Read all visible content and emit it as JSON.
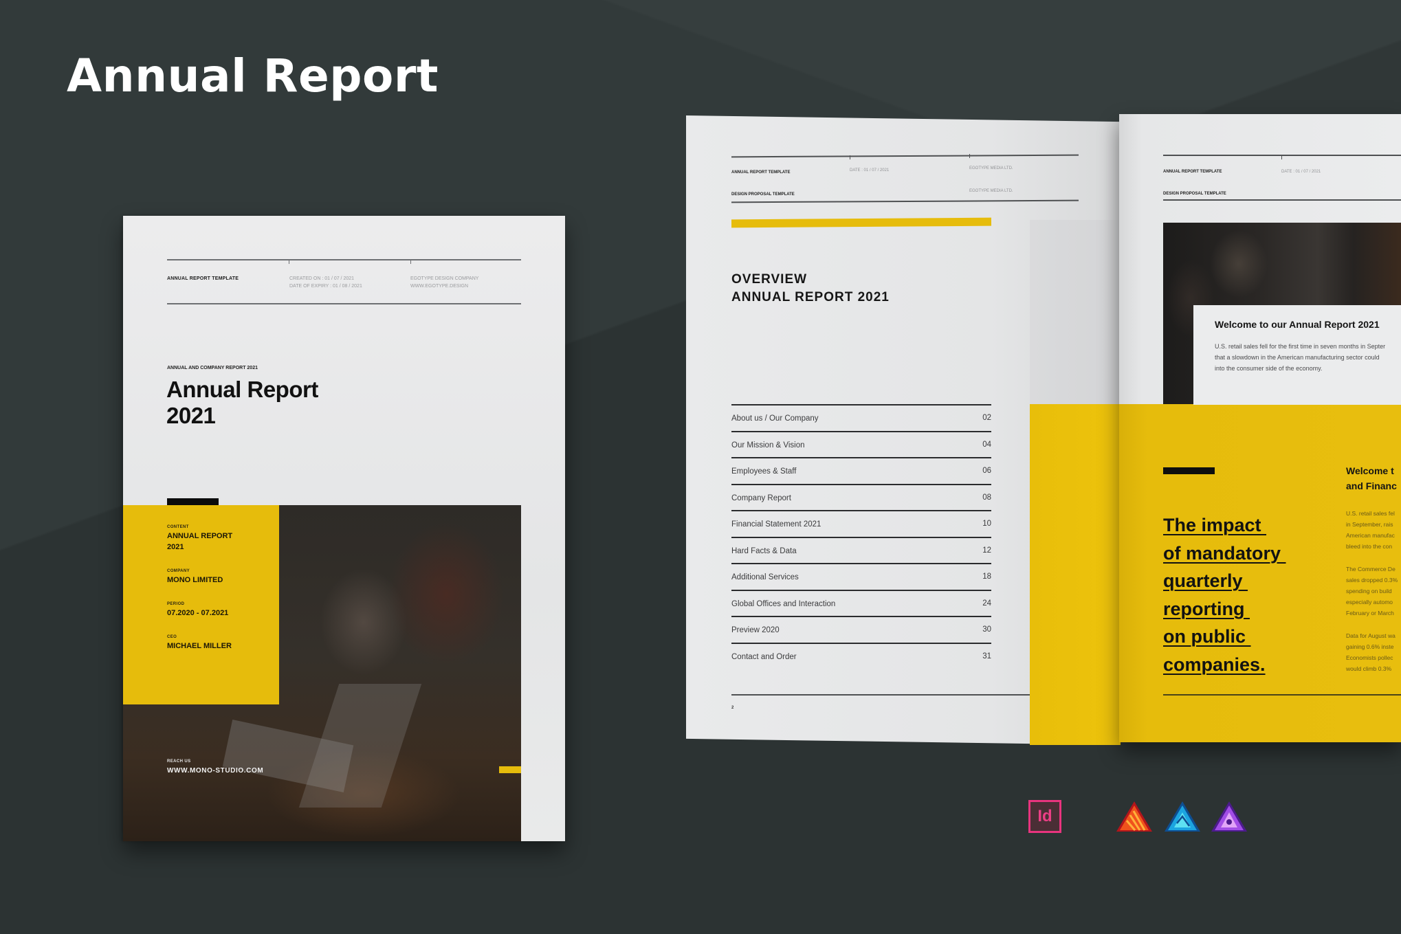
{
  "page_title": "Annual Report",
  "cover": {
    "header": {
      "label": "ANNUAL REPORT TEMPLATE",
      "created_on": "CREATED ON : 01 / 07 / 2021",
      "date_of_expiry": "DATE OF EXPIRY : 01 / 08 / 2021",
      "company": "EGOTYPE DESIGN COMPANY",
      "website": "WWW.EGOTYPE.DESIGN"
    },
    "subtitle": "ANNUAL AND COMPANY REPORT 2021",
    "title_line1": "Annual Report",
    "title_line2": "2021",
    "details": [
      {
        "label": "CONTENT",
        "value_line1": "ANNUAL REPORT",
        "value_line2": "2021"
      },
      {
        "label": "COMPANY",
        "value_line1": "MONO LIMITED"
      },
      {
        "label": "PERIOD",
        "value_line1": "07.2020 - 07.2021"
      },
      {
        "label": "CEO",
        "value_line1": "MICHAEL MILLER"
      }
    ],
    "reach_label": "REACH US",
    "reach_url": "WWW.MONO-STUDIO.COM"
  },
  "spread_left": {
    "header": {
      "label1": "ANNUAL REPORT TEMPLATE",
      "label2": "DESIGN PROPOSAL TEMPLATE",
      "date": "DATE : 01 / 07 / 2021",
      "company1": "EGOTYPE MEDIA LTD.",
      "company2": "EGOTYPE MEDIA LTD."
    },
    "overview_line1": "OVERVIEW",
    "overview_line2": "ANNUAL REPORT 2021",
    "toc": [
      {
        "label": "About us / Our Company",
        "page": "02"
      },
      {
        "label": "Our Mission & Vision",
        "page": "04"
      },
      {
        "label": "Employees & Staff",
        "page": "06"
      },
      {
        "label": "Company Report",
        "page": "08"
      },
      {
        "label": "Financial Statement 2021",
        "page": "10"
      },
      {
        "label": "Hard Facts & Data",
        "page": "12"
      },
      {
        "label": "Additional Services",
        "page": "18"
      },
      {
        "label": "Global Offices and Interaction",
        "page": "24"
      },
      {
        "label": "Preview 2020",
        "page": "30"
      },
      {
        "label": "Contact and Order",
        "page": "31"
      }
    ],
    "page_number": "2"
  },
  "spread_right": {
    "header": {
      "label1": "ANNUAL REPORT TEMPLATE",
      "label2": "DESIGN PROPOSAL TEMPLATE",
      "date": "DATE : 01 / 07 / 2021"
    },
    "welcome_title": "Welcome to our Annual Report 2021",
    "welcome_body": [
      "U.S. retail sales fell for the first time in seven months in Septer",
      "that a slowdown in the American manufacturing sector could",
      "into the consumer side of the economy."
    ],
    "impact_lines": [
      "The impact ",
      "of mandatory ",
      "quarterly ",
      "reporting ",
      "on public ",
      "companies."
    ],
    "welcome2_line1": "Welcome t",
    "welcome2_line2": "and Financ",
    "column_paragraphs": [
      [
        "U.S. retail sales fel",
        "in September, rais",
        "American manufac",
        "bleed into the con"
      ],
      [
        "The Commerce De",
        "sales dropped 0.3%",
        "spending on build",
        "especially automo",
        "February or March"
      ],
      [
        "Data for August wa",
        "gaining 0.6% inste",
        "Economists pollec",
        "would climb 0.3%"
      ]
    ]
  },
  "software_icons": [
    {
      "name": "Adobe InDesign",
      "glyph": "Id"
    },
    {
      "name": "Affinity Publisher"
    },
    {
      "name": "Affinity Designer"
    },
    {
      "name": "Affinity Photo"
    }
  ],
  "colors": {
    "background": "#323a3a",
    "accent_yellow": "#e6bc0c",
    "indesign_pink": "#e8347e"
  }
}
